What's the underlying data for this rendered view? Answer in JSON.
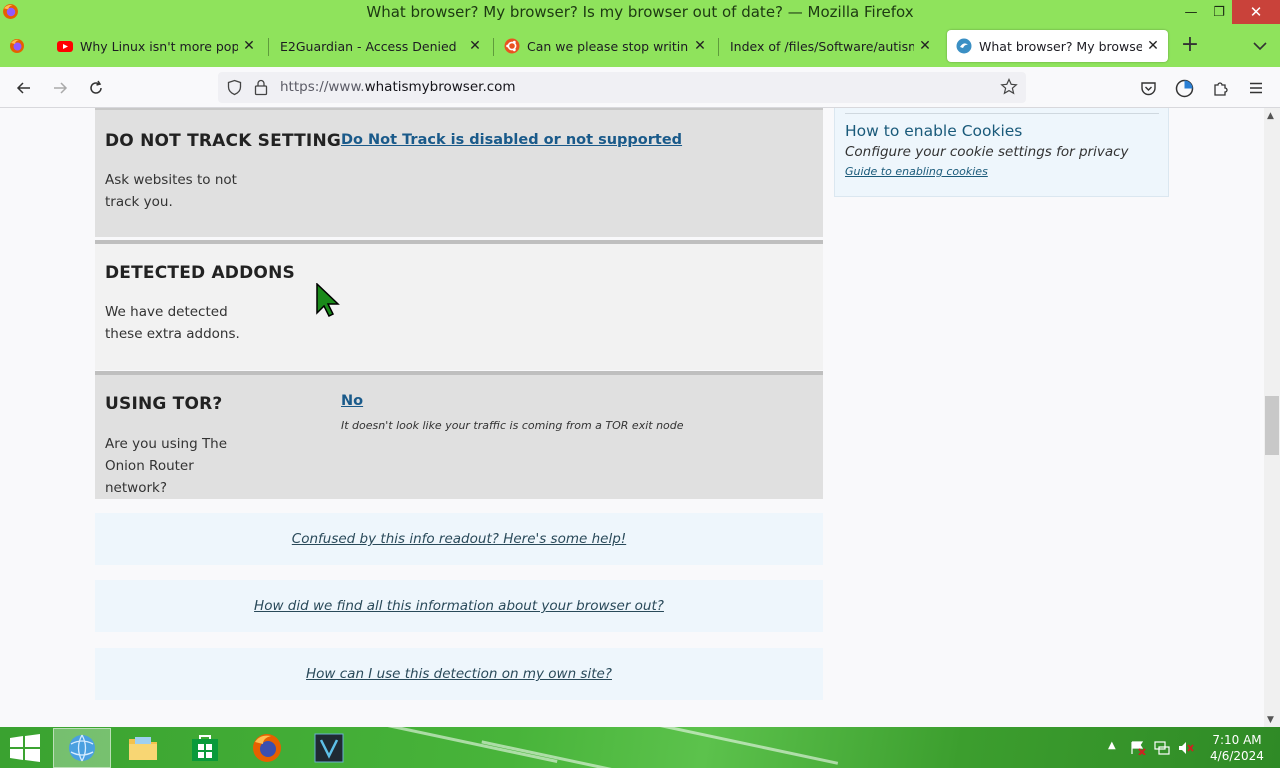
{
  "window": {
    "title": "What browser? My browser? Is my browser out of date? — Mozilla Firefox",
    "minimize_glyph": "—",
    "restore_glyph": "❐",
    "close_glyph": "✕"
  },
  "tabs": [
    {
      "label": "Why Linux isn't more popular -",
      "favicon": "youtube-icon",
      "active": false
    },
    {
      "label": "E2Guardian - Access Denied",
      "favicon": "none",
      "active": false
    },
    {
      "label": "Can we please stop writing stuff",
      "favicon": "ubuntu-icon",
      "active": false
    },
    {
      "label": "Index of /files/Software/autism/",
      "favicon": "none",
      "active": false
    },
    {
      "label": "What browser? My browser? Is m",
      "favicon": "whatismybrowser-icon",
      "active": true
    }
  ],
  "tab_close_glyph": "✕",
  "new_tab_glyph": "+",
  "urlbar": {
    "prefix": "https://www.",
    "host": "whatismybrowser.com"
  },
  "sections": {
    "dnt": {
      "title": "DO NOT TRACK SETTING",
      "desc": "Ask websites to not track you.",
      "link": "Do Not Track is disabled or not supported"
    },
    "addons": {
      "title": "DETECTED ADDONS",
      "desc": "We have detected these extra addons."
    },
    "tor": {
      "title": "USING TOR?",
      "desc": "Are you using The Onion Router network?",
      "link": "No",
      "note": "It doesn't look like your traffic is coming from a TOR exit node"
    }
  },
  "help_links": [
    "Confused by this info readout? Here's some help!",
    "How did we find all this information about your browser out?",
    "How can I use this detection on my own site?"
  ],
  "sidebar": {
    "title": "How to enable Cookies",
    "subtitle": "Configure your cookie settings for privacy",
    "link": "Guide to enabling cookies"
  },
  "taskbar": {
    "items": [
      "ie-icon",
      "file-explorer-icon",
      "store-icon",
      "firefox-icon",
      "vim-icon"
    ],
    "active_index": 0,
    "clock_time": "7:10 AM",
    "clock_date": "4/6/2024"
  },
  "colors": {
    "theme_green": "#8fe35c",
    "link_blue": "#1a5a8a",
    "section_grey": "#e0e0e0",
    "close_red": "#c9423a"
  }
}
